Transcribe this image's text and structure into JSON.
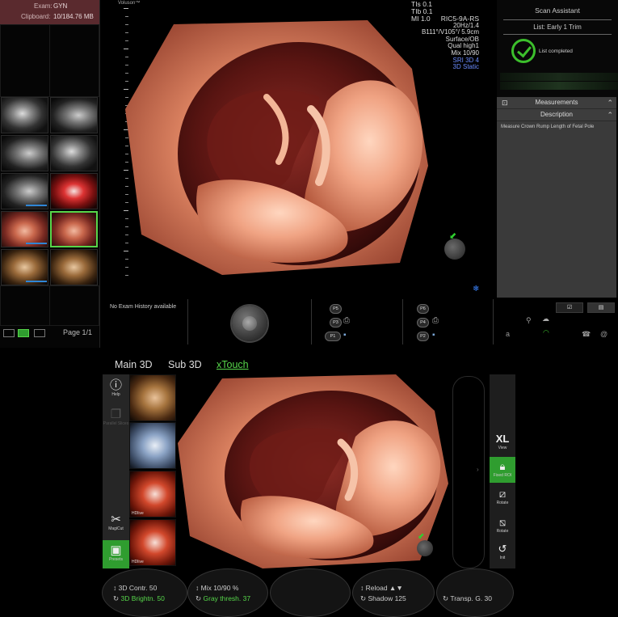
{
  "exam_panel": {
    "exam_label": "Exam:",
    "exam_value": "GYN",
    "clipboard_label": "Clipboard:",
    "clipboard_value": "10/184.76 MB",
    "page_info": "Page 1/1"
  },
  "viewport": {
    "logo": "Voluson™",
    "tis": "TIs",
    "tis_value": "0.1",
    "tib": "TIb",
    "tib_value": "0.1",
    "mi": "MI",
    "mi_value": "1.0",
    "probe": "RIC5-9A-RS",
    "params": [
      "20Hz/1.4",
      "B111°/V105°/ 5.9cm",
      "Surface/OB",
      "Qual high1",
      "Mix 10/90"
    ],
    "mode_lines": [
      "SRI 3D 4",
      "3D Static"
    ]
  },
  "assistant": {
    "title": "Scan Assistant",
    "list": "List: Early 1 Trim",
    "completed": "List completed",
    "measurements": "Measurements",
    "description": "Description",
    "description_text": "Measure Crown Rump Length of Fetal Pole"
  },
  "status": {
    "no_exam": "No Exam History available",
    "p_buttons": [
      "P5",
      "P3",
      "P1",
      "P6",
      "P4",
      "P2"
    ]
  },
  "touch": {
    "tabs": [
      "Main 3D",
      "Sub 3D",
      "xTouch"
    ],
    "left_tools": {
      "help": "Help",
      "parallel": "Parallel Slices",
      "magicut": "MagiCut",
      "presets": "Presets"
    },
    "presets": [
      "",
      "",
      "HDlive",
      "HDlive"
    ],
    "right_tools": {
      "view_big": "XL",
      "view": "View",
      "fixed_roi": "Fixed ROI",
      "rotate1": "Rotate",
      "rotate2": "Rotate",
      "init": "Init"
    },
    "knobs": {
      "k1_top": "3D Contr. 50",
      "k1_bottom": "3D Brightn. 50",
      "k2_top": "Mix 10/90 %",
      "k2_bottom": "Gray thresh. 37",
      "k4_top": "Reload ▲▼",
      "k4_bottom": "Shadow 125",
      "k5_bottom": "Transp. G. 30"
    }
  },
  "colors": {
    "accent_green": "#56d64a",
    "exam_box": "#5a2a2e",
    "mode_blue": "#6b8cff"
  }
}
